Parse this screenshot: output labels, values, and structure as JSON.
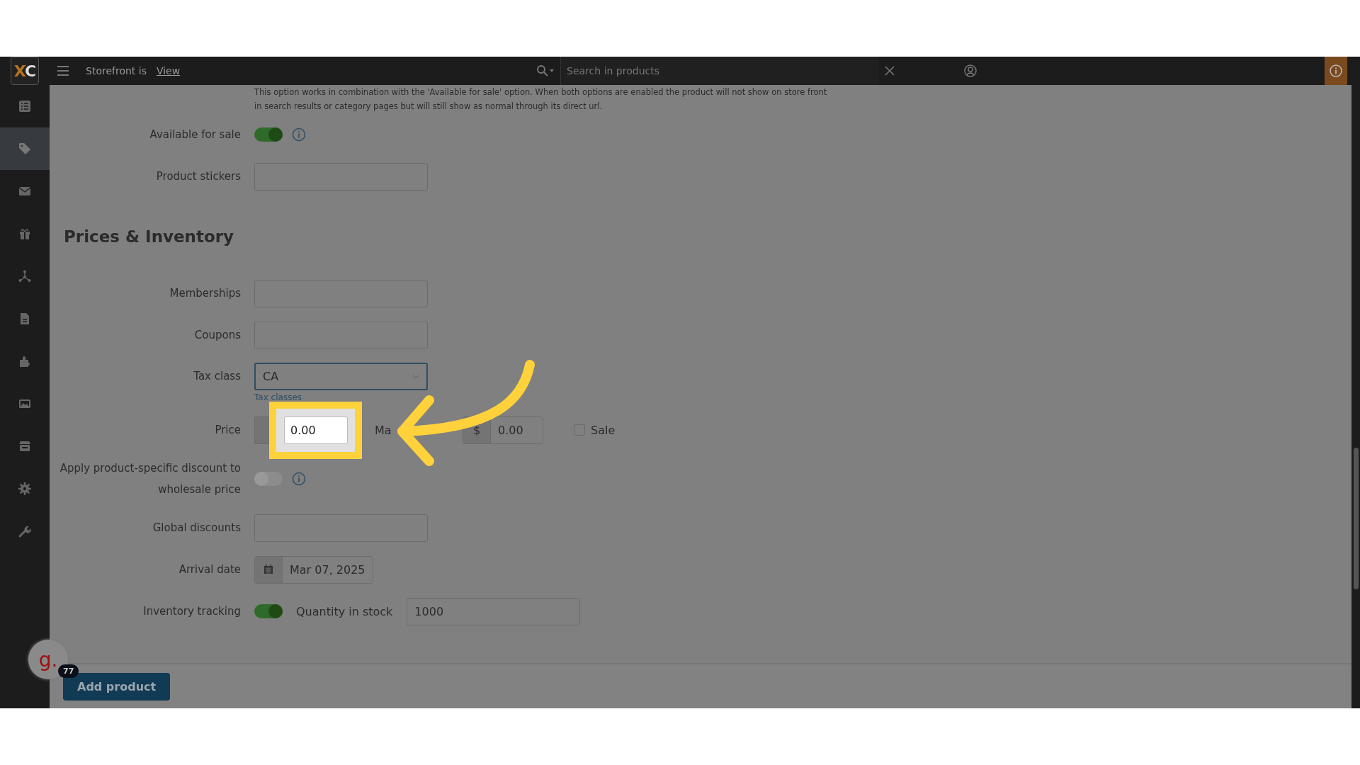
{
  "header": {
    "logo": "XC",
    "storefront_label": "Storefront is",
    "view_link": "View",
    "search": {
      "placeholder": "Search in products"
    }
  },
  "sidebar": {
    "items": [
      {
        "selected": false
      },
      {
        "selected": true
      },
      {
        "selected": false
      },
      {
        "selected": false
      },
      {
        "selected": false
      },
      {
        "selected": false
      },
      {
        "selected": false
      },
      {
        "selected": false
      },
      {
        "selected": false
      },
      {
        "selected": false
      },
      {
        "selected": false
      }
    ]
  },
  "notice": "This option works in combination with the 'Available for sale' option. When both options are enabled the product will not show on store front in search results or category pages but will still show as normal through its direct url.",
  "top_rows": [
    {
      "kind": "toggle",
      "label": "Available for sale",
      "on": true
    },
    {
      "kind": "text",
      "label": "Product stickers"
    }
  ],
  "section_title": "Prices & Inventory",
  "rows": [
    {
      "kind": "text",
      "label": "Memberships"
    },
    {
      "kind": "text",
      "label": "Coupons"
    },
    {
      "kind": "select",
      "label": "Tax class",
      "value": "CA",
      "link": "Tax classes"
    },
    {
      "kind": "price",
      "label": "Price",
      "value": "0.00",
      "market_label": "Ma",
      "market_prefix": "$",
      "market_value": "0.00",
      "sale_label": "Sale",
      "sale_checked": false
    },
    {
      "kind": "toggle",
      "label": "Apply product-specific discount to wholesale price",
      "on": false
    },
    {
      "kind": "text",
      "label": "Global discounts"
    },
    {
      "kind": "date",
      "label": "Arrival date",
      "value": "Mar 07, 2025"
    },
    {
      "kind": "inventory",
      "label": "Inventory tracking",
      "on": true,
      "qty_label": "Quantity in stock",
      "qty_value": "1000"
    }
  ],
  "footer": {
    "button": "Add product"
  },
  "chat_widget": {
    "logo": "g.",
    "badge": "77"
  }
}
